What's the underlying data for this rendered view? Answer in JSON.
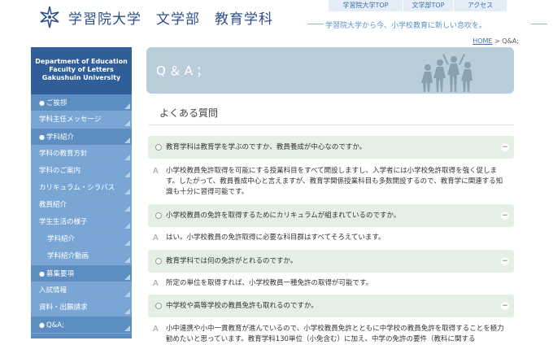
{
  "header": {
    "site_title": "学習院大学　文学部　教育学科",
    "top_links": [
      "学習院大学TOP",
      "文学部TOP",
      "アクセス"
    ],
    "tagline": "学習院大学から今、小学校教育に新しい息吹を。"
  },
  "breadcrumb": {
    "home": "HOME",
    "separator": " > ",
    "current": "Q&A;"
  },
  "sidebar": {
    "dept_lines": [
      "Department of Education",
      "Faculty of Letters",
      "Gakushuin University"
    ],
    "items": [
      {
        "label": "ご挨拶",
        "kind": "section",
        "bullet": "●"
      },
      {
        "label": "学科主任メッセージ",
        "kind": "sub"
      },
      {
        "label": "学科紹介",
        "kind": "section",
        "bullet": "●"
      },
      {
        "label": "学科の教育方針",
        "kind": "sub"
      },
      {
        "label": "学科のご案内",
        "kind": "sub"
      },
      {
        "label": "カリキュラム・シラバス",
        "kind": "sub"
      },
      {
        "label": "教員紹介",
        "kind": "sub"
      },
      {
        "label": "学生生活の様子",
        "kind": "sub"
      },
      {
        "label": "学科紹介",
        "kind": "sub2"
      },
      {
        "label": "学科紹介動画",
        "kind": "sub2"
      },
      {
        "label": "募集要項",
        "kind": "section",
        "bullet": "●"
      },
      {
        "label": "入試情報",
        "kind": "sub"
      },
      {
        "label": "資料・出願請求",
        "kind": "sub"
      },
      {
        "label": "Q&A;",
        "kind": "section",
        "bullet": "●"
      }
    ]
  },
  "main": {
    "banner_title": "Q＆A；",
    "faq_heading": "よくある質問",
    "faqs": [
      {
        "q": "教育学科は教育学を学ぶのですか、教員養成が中心なのですか。",
        "a": "小学校教員免許取得を可能にする授業科目をすべて開設しますし、入学者には小学校免許取得を強く促します。したがって、教員養成中心と言えますが、教育学関係授業科目も多数開設するので、教育学に関連する知識も十分に習得可能です。"
      },
      {
        "q": "小学校教員の免許を取得するためにカリキュラムが組まれているのですか。",
        "a": "はい。小学校教員の免許取得に必要な科目群はすべてそろえています。"
      },
      {
        "q": "教育学科では何の免許がとれるのですか。",
        "a": "所定の単位を取得すれば、小学校教員一種免許の取得が可能です。"
      },
      {
        "q": "中学校や高等学校の教員免許も取れるのですか。",
        "a": "小中連携や小中一貫教育が進んでいるので、小学校教員免許とともに中学校の教員免許を取得することを極力勧めたいと思っています。教育学科130単位（小免含む）に加え、中学の免許の要件（教科に関する"
      }
    ],
    "answer_mark": "A",
    "collapse_symbol": "−"
  },
  "colors": {
    "brand_blue": "#2c4f8a",
    "sidebar": "#5d8ec2",
    "sidebar_sub": "#79a6d5",
    "question_bg": "#e4efe6",
    "banner": "#b9ced9"
  }
}
